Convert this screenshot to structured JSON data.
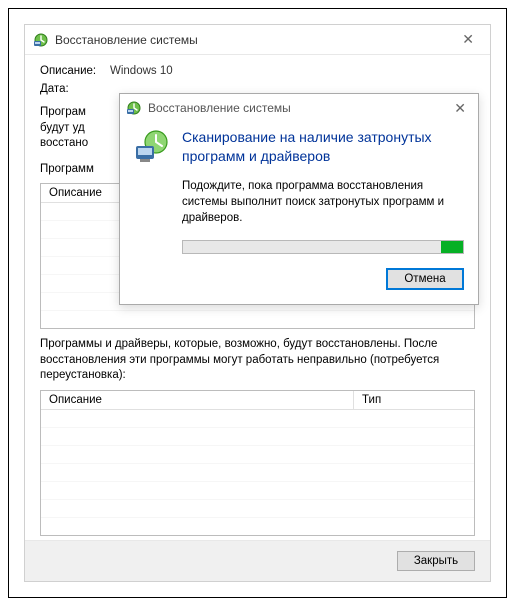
{
  "main": {
    "title": "Восстановление системы",
    "desc_label": "Описание:",
    "desc_value": "Windows 10",
    "date_label": "Дата:",
    "para1_line1": "Програм",
    "para1_line2": "будут уд",
    "para1_line3": "восстано",
    "section1_label": "Программ",
    "tbl_col_desc": "Описание",
    "tbl_col_type": "Тип",
    "para2": "Программы и драйверы, которые, возможно, будут восстановлены. После восстановления эти программы могут работать неправильно (потребуется переустановка):",
    "close_btn": "Закрыть"
  },
  "dialog": {
    "title": "Восстановление системы",
    "heading": "Сканирование на наличие затронутых программ и драйверов",
    "body": "Подождите, пока программа восстановления системы выполнит поиск затронутых программ и драйверов.",
    "cancel": "Отмена"
  }
}
